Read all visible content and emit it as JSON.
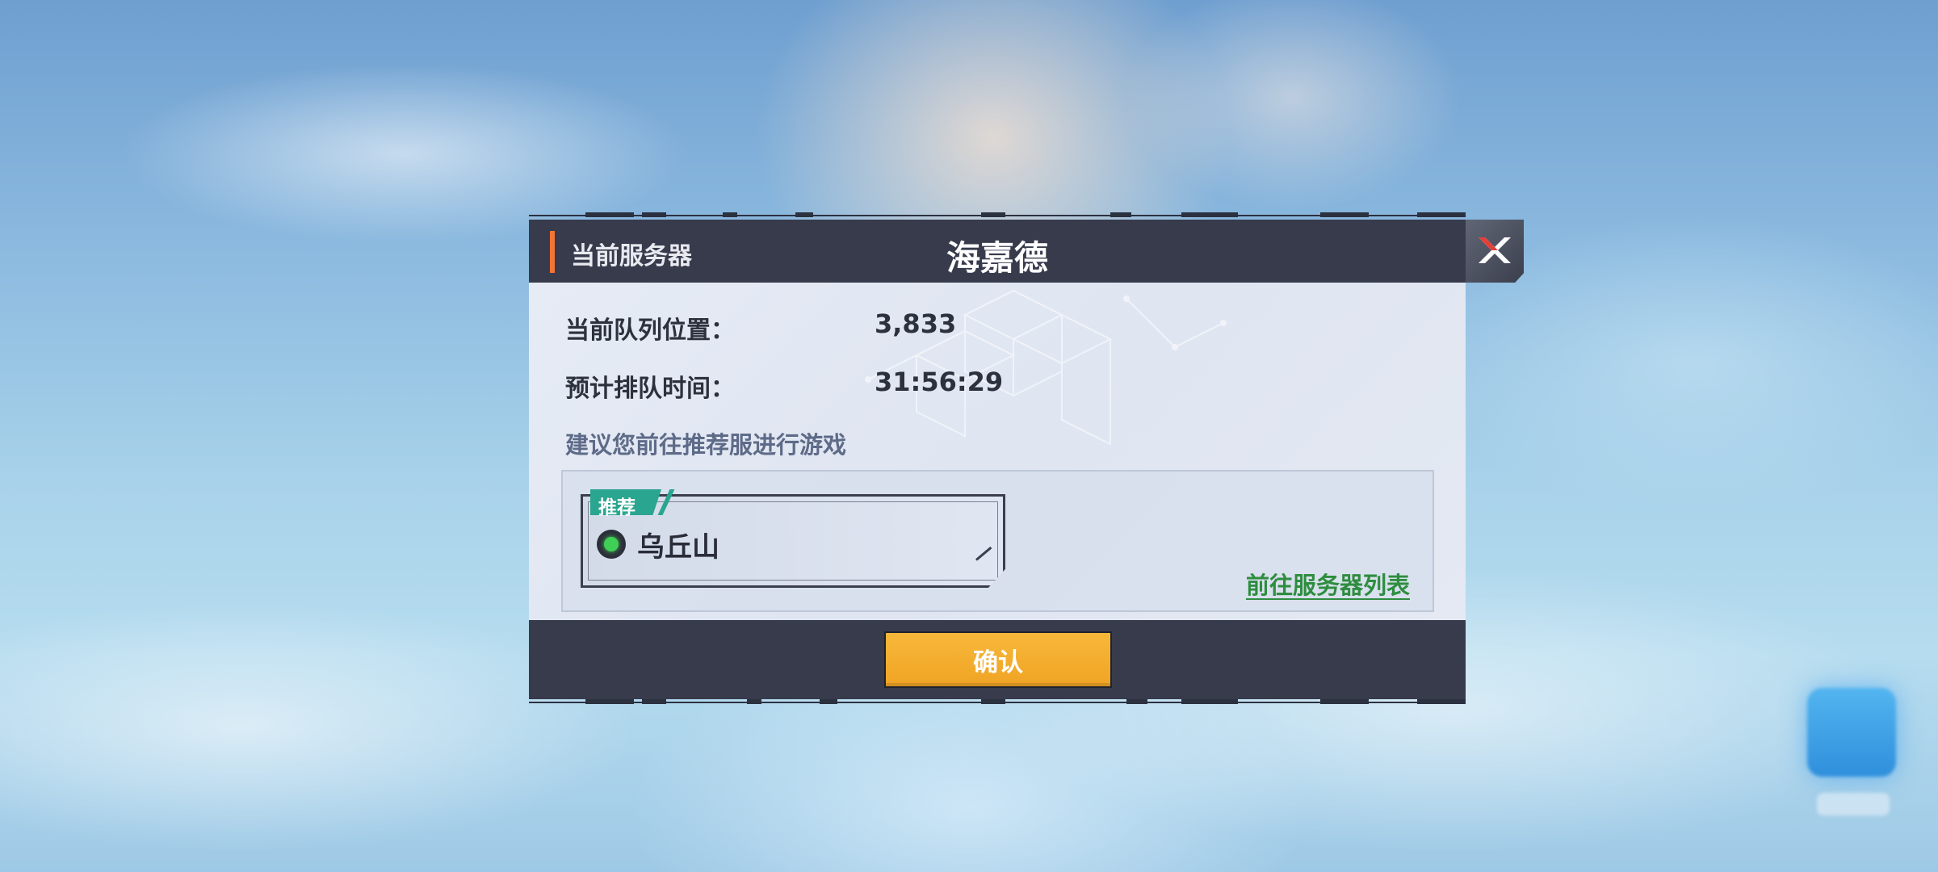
{
  "dialog": {
    "server_label": "当前服务器",
    "server_name": "海嘉德",
    "queue_position_label": "当前队列位置：",
    "queue_position_value": "3,833",
    "wait_time_label": "预计排队时间：",
    "wait_time_value": "31:56:29",
    "suggestion_text": "建议您前往推荐服进行游戏",
    "recommended": {
      "tag": "推荐",
      "server_name": "乌丘山",
      "status_color": "#3fcf55"
    },
    "server_list_link": "前往服务器列表",
    "confirm_button": "确认"
  },
  "colors": {
    "header_bg": "#373b4c",
    "accent": "#f27536",
    "confirm_bg": "#f0a324",
    "tag_bg": "#2aa58f",
    "link": "#2e8d3f"
  },
  "icons": {
    "close": "close-x-icon",
    "status": "online-status-icon"
  }
}
